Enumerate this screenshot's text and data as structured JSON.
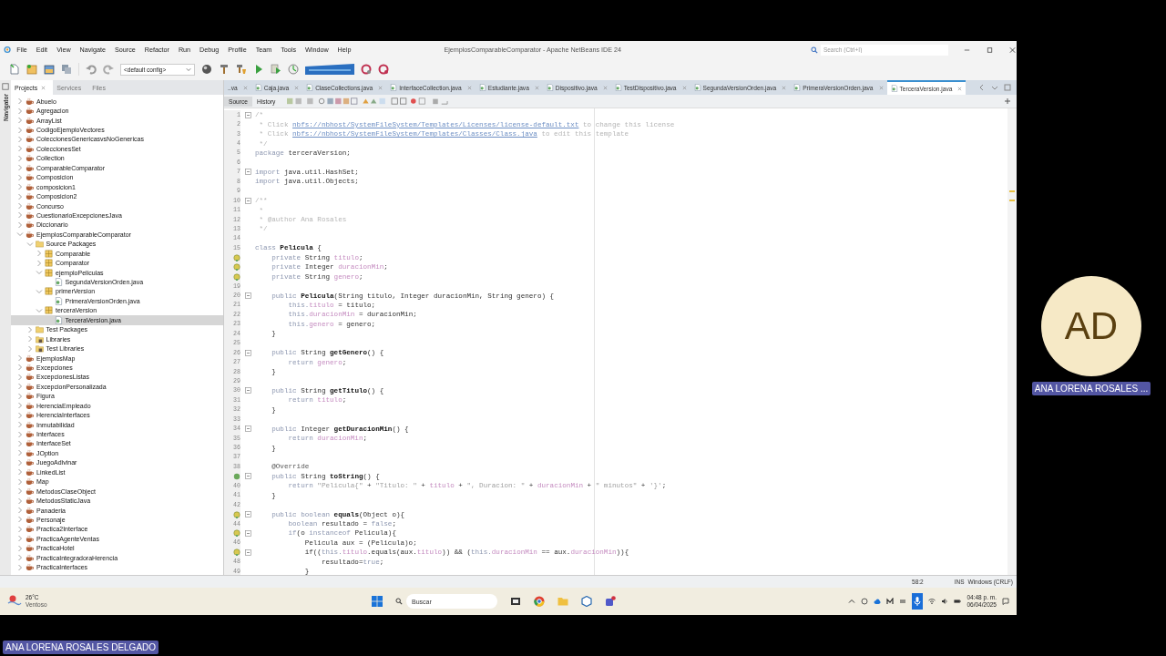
{
  "meeting": {
    "presenter": "ANA LORENA ROSALES DELGADO",
    "participant": {
      "initials": "AD",
      "name": "ANA LORENA ROSALES ..."
    }
  },
  "ide": {
    "title": "EjemplosComparableComparator - Apache NetBeans IDE 24",
    "menu": [
      "File",
      "Edit",
      "View",
      "Navigate",
      "Source",
      "Refactor",
      "Run",
      "Debug",
      "Profile",
      "Team",
      "Tools",
      "Window",
      "Help"
    ],
    "search": {
      "placeholder": "Search (Ctrl+I)"
    },
    "config": "<default config>",
    "side_tabs": [
      {
        "label": "Projects",
        "selected": true
      },
      {
        "label": "Services",
        "selected": false
      },
      {
        "label": "Files",
        "selected": false
      }
    ],
    "navigator": "Navigator",
    "project_tree": [
      {
        "label": "Abuelo",
        "kind": "project",
        "expanded": false,
        "selected": false
      },
      {
        "label": "Agregacion",
        "kind": "project",
        "expanded": false,
        "selected": false
      },
      {
        "label": "ArrayList",
        "kind": "project",
        "expanded": false,
        "selected": false
      },
      {
        "label": "CodigoEjemploVectores",
        "kind": "project",
        "expanded": false,
        "selected": false
      },
      {
        "label": "ColeccionesGenericasvsNoGenericas",
        "kind": "project",
        "expanded": false,
        "selected": false
      },
      {
        "label": "ColeccionesSet",
        "kind": "project",
        "expanded": false,
        "selected": false
      },
      {
        "label": "Collection",
        "kind": "project",
        "expanded": false,
        "selected": false
      },
      {
        "label": "ComparableComparator",
        "kind": "project",
        "expanded": false,
        "selected": false
      },
      {
        "label": "Composicion",
        "kind": "project",
        "expanded": false,
        "selected": false
      },
      {
        "label": "composicion1",
        "kind": "project",
        "expanded": false,
        "selected": false
      },
      {
        "label": "Composicion2",
        "kind": "project",
        "expanded": false,
        "selected": false
      },
      {
        "label": "Concurso",
        "kind": "project",
        "expanded": false,
        "selected": false
      },
      {
        "label": "CuestionarioExcepcionesJava",
        "kind": "project",
        "expanded": false,
        "selected": false
      },
      {
        "label": "Diccionario",
        "kind": "project",
        "expanded": false,
        "selected": false
      },
      {
        "label": "EjemplosComparableComparator",
        "kind": "project",
        "expanded": true,
        "selected": false,
        "children": [
          {
            "label": "Source Packages",
            "kind": "sources",
            "expanded": true,
            "selected": false,
            "children": [
              {
                "label": "Comparable",
                "kind": "package",
                "expanded": false,
                "selected": false
              },
              {
                "label": "Comparator",
                "kind": "package",
                "expanded": false,
                "selected": false
              },
              {
                "label": "ejemploPeliculas",
                "kind": "package",
                "expanded": true,
                "selected": false,
                "children": [
                  {
                    "label": "SegundaVersionOrden.java",
                    "kind": "file",
                    "selected": false
                  }
                ]
              },
              {
                "label": "primerVersion",
                "kind": "package",
                "expanded": true,
                "selected": false,
                "children": [
                  {
                    "label": "PrimeraVersionOrden.java",
                    "kind": "file",
                    "selected": false
                  }
                ]
              },
              {
                "label": "terceraVersion",
                "kind": "package",
                "expanded": true,
                "selected": false,
                "children": [
                  {
                    "label": "TerceraVersion.java",
                    "kind": "file",
                    "selected": true
                  }
                ]
              }
            ]
          },
          {
            "label": "Test Packages",
            "kind": "sources",
            "expanded": false,
            "selected": false
          },
          {
            "label": "Libraries",
            "kind": "libraries",
            "expanded": false,
            "selected": false
          },
          {
            "label": "Test Libraries",
            "kind": "libraries",
            "expanded": false,
            "selected": false
          }
        ]
      },
      {
        "label": "EjemplosMap",
        "kind": "project",
        "expanded": false,
        "selected": false
      },
      {
        "label": "Excepciones",
        "kind": "project",
        "expanded": false,
        "selected": false
      },
      {
        "label": "ExcepcionesListas",
        "kind": "project",
        "expanded": false,
        "selected": false
      },
      {
        "label": "ExcepcionPersonalizada",
        "kind": "project",
        "expanded": false,
        "selected": false
      },
      {
        "label": "Figura",
        "kind": "project",
        "expanded": false,
        "selected": false
      },
      {
        "label": "HerenciaEmpleado",
        "kind": "project",
        "expanded": false,
        "selected": false
      },
      {
        "label": "HerenciaInterfaces",
        "kind": "project",
        "expanded": false,
        "selected": false
      },
      {
        "label": "Inmutabilidad",
        "kind": "project",
        "expanded": false,
        "selected": false
      },
      {
        "label": "Interfaces",
        "kind": "project",
        "expanded": false,
        "selected": false
      },
      {
        "label": "InterfaceSet",
        "kind": "project",
        "expanded": false,
        "selected": false
      },
      {
        "label": "JOption",
        "kind": "project",
        "expanded": false,
        "selected": false
      },
      {
        "label": "JuegoAdivinar",
        "kind": "project",
        "expanded": false,
        "selected": false
      },
      {
        "label": "LinkedList",
        "kind": "project",
        "expanded": false,
        "selected": false
      },
      {
        "label": "Map",
        "kind": "project",
        "expanded": false,
        "selected": false
      },
      {
        "label": "MetodosClaseObject",
        "kind": "project",
        "expanded": false,
        "selected": false
      },
      {
        "label": "MetodosStaticJava",
        "kind": "project",
        "expanded": false,
        "selected": false
      },
      {
        "label": "Panaderia",
        "kind": "project",
        "expanded": false,
        "selected": false
      },
      {
        "label": "Personaje",
        "kind": "project",
        "expanded": false,
        "selected": false
      },
      {
        "label": "Practica2Interface",
        "kind": "project",
        "expanded": false,
        "selected": false
      },
      {
        "label": "PracticaAgenteVentas",
        "kind": "project",
        "expanded": false,
        "selected": false
      },
      {
        "label": "PracticaHotel",
        "kind": "project",
        "expanded": false,
        "selected": false
      },
      {
        "label": "PracticaIntegradoraHerencia",
        "kind": "project",
        "expanded": false,
        "selected": false
      },
      {
        "label": "PracticaInterfaces",
        "kind": "project",
        "expanded": false,
        "selected": false
      }
    ],
    "editor_tabs": [
      {
        "label": "..va",
        "selected": false
      },
      {
        "label": "Caja.java",
        "selected": false
      },
      {
        "label": "ClaseCollections.java",
        "selected": false
      },
      {
        "label": "InterfaceCollection.java",
        "selected": false
      },
      {
        "label": "Estudiante.java",
        "selected": false
      },
      {
        "label": "Dispositivo.java",
        "selected": false
      },
      {
        "label": "TestDispositivo.java",
        "selected": false
      },
      {
        "label": "SegundaVersionOrden.java",
        "selected": false
      },
      {
        "label": "PrimeraVersionOrden.java",
        "selected": false
      },
      {
        "label": "TerceraVersion.java",
        "selected": true
      }
    ],
    "editor_views": [
      {
        "label": "Source",
        "selected": true
      },
      {
        "label": "History",
        "selected": false
      }
    ],
    "code": [
      {
        "number": "1",
        "fold": true,
        "segs": [
          {
            "kind": "comment",
            "text": "/*"
          }
        ]
      },
      {
        "number": "2",
        "fold": false,
        "segs": [
          {
            "kind": "comment",
            "text": " * Click "
          },
          {
            "kind": "link",
            "text": "nbfs://nbhost/SystemFileSystem/Templates/Licenses/license-default.txt"
          },
          {
            "kind": "comment",
            "text": " to change this license"
          }
        ]
      },
      {
        "number": "3",
        "fold": false,
        "segs": [
          {
            "kind": "comment",
            "text": " * Click "
          },
          {
            "kind": "link",
            "text": "nbfs://nbhost/SystemFileSystem/Templates/Classes/Class.java"
          },
          {
            "kind": "comment",
            "text": " to edit this template"
          }
        ]
      },
      {
        "number": "4",
        "fold": false,
        "segs": [
          {
            "kind": "comment",
            "text": " */"
          }
        ]
      },
      {
        "number": "5",
        "fold": false,
        "segs": [
          {
            "kind": "keyword",
            "text": "package"
          },
          {
            "kind": "plain",
            "text": " terceraVersion;"
          }
        ]
      },
      {
        "number": "6",
        "fold": false
      },
      {
        "number": "7",
        "fold": true,
        "segs": [
          {
            "kind": "keyword",
            "text": "import"
          },
          {
            "kind": "plain",
            "text": " java.util.HashSet;"
          }
        ]
      },
      {
        "number": "8",
        "fold": false,
        "segs": [
          {
            "kind": "keyword",
            "text": "import"
          },
          {
            "kind": "plain",
            "text": " java.util.Objects;"
          }
        ]
      },
      {
        "number": "9",
        "fold": false
      },
      {
        "number": "10",
        "fold": true,
        "segs": [
          {
            "kind": "comment",
            "text": "/**"
          }
        ]
      },
      {
        "number": "11",
        "fold": false,
        "segs": [
          {
            "kind": "comment",
            "text": " *"
          }
        ]
      },
      {
        "number": "12",
        "fold": false,
        "segs": [
          {
            "kind": "comment",
            "text": " * @author Ana Rosales"
          }
        ]
      },
      {
        "number": "13",
        "fold": false,
        "segs": [
          {
            "kind": "comment",
            "text": " */"
          }
        ]
      },
      {
        "number": "14",
        "fold": false
      },
      {
        "number": "15",
        "fold": false,
        "segs": [
          {
            "kind": "keyword",
            "text": "class "
          },
          {
            "kind": "name",
            "text": "Pelicula"
          },
          {
            "kind": "plain",
            "text": " {"
          }
        ]
      },
      {
        "kind": "hint",
        "fold": false,
        "segs": [
          {
            "kind": "keyword",
            "text": "    private"
          },
          {
            "kind": "plain",
            "text": " String "
          },
          {
            "kind": "field",
            "text": "titulo"
          },
          {
            "kind": "plain",
            "text": ";"
          }
        ]
      },
      {
        "kind": "hint",
        "fold": false,
        "segs": [
          {
            "kind": "keyword",
            "text": "    private"
          },
          {
            "kind": "plain",
            "text": " Integer "
          },
          {
            "kind": "field",
            "text": "duracionMin"
          },
          {
            "kind": "plain",
            "text": ";"
          }
        ]
      },
      {
        "kind": "hint",
        "fold": false,
        "segs": [
          {
            "kind": "keyword",
            "text": "    private"
          },
          {
            "kind": "plain",
            "text": " String "
          },
          {
            "kind": "field",
            "text": "genero"
          },
          {
            "kind": "plain",
            "text": ";"
          }
        ]
      },
      {
        "number": "19",
        "fold": false
      },
      {
        "number": "20",
        "fold": true,
        "segs": [
          {
            "kind": "keyword",
            "text": "    public "
          },
          {
            "kind": "name",
            "text": "Pelicula"
          },
          {
            "kind": "plain",
            "text": "(String titulo, Integer duracionMin, String genero) {"
          }
        ]
      },
      {
        "number": "21",
        "fold": false,
        "segs": [
          {
            "kind": "keyword",
            "text": "        this."
          },
          {
            "kind": "field",
            "text": "titulo"
          },
          {
            "kind": "plain",
            "text": " = titulo;"
          }
        ]
      },
      {
        "number": "22",
        "fold": false,
        "segs": [
          {
            "kind": "keyword",
            "text": "        this."
          },
          {
            "kind": "field",
            "text": "duracionMin"
          },
          {
            "kind": "plain",
            "text": " = duracionMin;"
          }
        ]
      },
      {
        "number": "23",
        "fold": false,
        "segs": [
          {
            "kind": "keyword",
            "text": "        this."
          },
          {
            "kind": "field",
            "text": "genero"
          },
          {
            "kind": "plain",
            "text": " = genero;"
          }
        ]
      },
      {
        "number": "24",
        "fold": false,
        "segs": [
          {
            "kind": "plain",
            "text": "    }"
          }
        ]
      },
      {
        "number": "25",
        "fold": false
      },
      {
        "number": "26",
        "fold": true,
        "segs": [
          {
            "kind": "keyword",
            "text": "    public"
          },
          {
            "kind": "plain",
            "text": " String "
          },
          {
            "kind": "name",
            "text": "getGenero"
          },
          {
            "kind": "plain",
            "text": "() {"
          }
        ]
      },
      {
        "number": "27",
        "fold": false,
        "segs": [
          {
            "kind": "keyword",
            "text": "        return "
          },
          {
            "kind": "field",
            "text": "genero"
          },
          {
            "kind": "plain",
            "text": ";"
          }
        ]
      },
      {
        "number": "28",
        "fold": false,
        "segs": [
          {
            "kind": "plain",
            "text": "    }"
          }
        ]
      },
      {
        "number": "29",
        "fold": false
      },
      {
        "number": "30",
        "fold": true,
        "segs": [
          {
            "kind": "keyword",
            "text": "    public"
          },
          {
            "kind": "plain",
            "text": " String "
          },
          {
            "kind": "name",
            "text": "getTitulo"
          },
          {
            "kind": "plain",
            "text": "() {"
          }
        ]
      },
      {
        "number": "31",
        "fold": false,
        "segs": [
          {
            "kind": "keyword",
            "text": "        return "
          },
          {
            "kind": "field",
            "text": "titulo"
          },
          {
            "kind": "plain",
            "text": ";"
          }
        ]
      },
      {
        "number": "32",
        "fold": false,
        "segs": [
          {
            "kind": "plain",
            "text": "    }"
          }
        ]
      },
      {
        "number": "33",
        "fold": false
      },
      {
        "number": "34",
        "fold": true,
        "segs": [
          {
            "kind": "keyword",
            "text": "    public"
          },
          {
            "kind": "plain",
            "text": " Integer "
          },
          {
            "kind": "name",
            "text": "getDuracionMin"
          },
          {
            "kind": "plain",
            "text": "() {"
          }
        ]
      },
      {
        "number": "35",
        "fold": false,
        "segs": [
          {
            "kind": "keyword",
            "text": "        return "
          },
          {
            "kind": "field",
            "text": "duracionMin"
          },
          {
            "kind": "plain",
            "text": ";"
          }
        ]
      },
      {
        "number": "36",
        "fold": false,
        "segs": [
          {
            "kind": "plain",
            "text": "    }"
          }
        ]
      },
      {
        "number": "37",
        "fold": false
      },
      {
        "number": "38",
        "fold": false,
        "segs": [
          {
            "kind": "annotation",
            "text": "    @Override"
          }
        ]
      },
      {
        "kind": "override",
        "fold": true,
        "segs": [
          {
            "kind": "keyword",
            "text": "    public"
          },
          {
            "kind": "plain",
            "text": " String "
          },
          {
            "kind": "name",
            "text": "toString"
          },
          {
            "kind": "plain",
            "text": "() {"
          }
        ]
      },
      {
        "number": "40",
        "fold": false,
        "segs": [
          {
            "kind": "keyword",
            "text": "        return "
          },
          {
            "kind": "string",
            "text": "\"Pelicula{\""
          },
          {
            "kind": "plain",
            "text": " + "
          },
          {
            "kind": "string",
            "text": "\"Titulo: \""
          },
          {
            "kind": "plain",
            "text": " + "
          },
          {
            "kind": "field",
            "text": "titulo"
          },
          {
            "kind": "plain",
            "text": " + "
          },
          {
            "kind": "string",
            "text": "\", Duracion: \""
          },
          {
            "kind": "plain",
            "text": " + "
          },
          {
            "kind": "field",
            "text": "duracionMin"
          },
          {
            "kind": "plain",
            "text": " + "
          },
          {
            "kind": "string",
            "text": "\" minutos\""
          },
          {
            "kind": "plain",
            "text": " + "
          },
          {
            "kind": "string",
            "text": "'}'"
          },
          {
            "kind": "plain",
            "text": ";"
          }
        ]
      },
      {
        "number": "41",
        "fold": false,
        "segs": [
          {
            "kind": "plain",
            "text": "    }"
          }
        ]
      },
      {
        "number": "42",
        "fold": false
      },
      {
        "kind": "hint",
        "fold": true,
        "segs": [
          {
            "kind": "keyword",
            "text": "    public boolean "
          },
          {
            "kind": "name",
            "text": "equals"
          },
          {
            "kind": "plain",
            "text": "(Object o){"
          }
        ]
      },
      {
        "number": "44",
        "fold": false,
        "segs": [
          {
            "kind": "keyword",
            "text": "        boolean"
          },
          {
            "kind": "plain",
            "text": " resultado = "
          },
          {
            "kind": "keyword",
            "text": "false"
          },
          {
            "kind": "plain",
            "text": ";"
          }
        ]
      },
      {
        "kind": "hint",
        "fold": true,
        "segs": [
          {
            "kind": "keyword",
            "text": "        if"
          },
          {
            "kind": "plain",
            "text": "(o "
          },
          {
            "kind": "keyword",
            "text": "instanceof"
          },
          {
            "kind": "plain",
            "text": " Pelicula){"
          }
        ]
      },
      {
        "number": "46",
        "fold": false,
        "segs": [
          {
            "kind": "plain",
            "text": "            Pelicula aux = (Pelicula)o;"
          }
        ]
      },
      {
        "kind": "hint",
        "fold": true,
        "segs": [
          {
            "kind": "plain",
            "text": "            if(("
          },
          {
            "kind": "keyword",
            "text": "this."
          },
          {
            "kind": "field",
            "text": "titulo"
          },
          {
            "kind": "plain",
            "text": ".equals(aux."
          },
          {
            "kind": "field",
            "text": "titulo"
          },
          {
            "kind": "plain",
            "text": ")) && ("
          },
          {
            "kind": "keyword",
            "text": "this."
          },
          {
            "kind": "field",
            "text": "duracionMin"
          },
          {
            "kind": "plain",
            "text": " == aux."
          },
          {
            "kind": "field",
            "text": "duracionMin"
          },
          {
            "kind": "plain",
            "text": ")){"
          }
        ]
      },
      {
        "number": "48",
        "fold": false,
        "segs": [
          {
            "kind": "plain",
            "text": "                resultado="
          },
          {
            "kind": "keyword",
            "text": "true"
          },
          {
            "kind": "plain",
            "text": ";"
          }
        ]
      },
      {
        "number": "49",
        "fold": false,
        "segs": [
          {
            "kind": "plain",
            "text": "            }"
          }
        ]
      }
    ],
    "status": {
      "position": "58:2",
      "mode": "INS",
      "line_endings": "Windows (CRLF)"
    }
  },
  "taskbar": {
    "weather": {
      "temperature": "26°C",
      "condition": "Ventoso"
    },
    "search": {
      "placeholder": "Buscar"
    },
    "time": "04:48 p. m.",
    "date": "06/04/2025"
  }
}
